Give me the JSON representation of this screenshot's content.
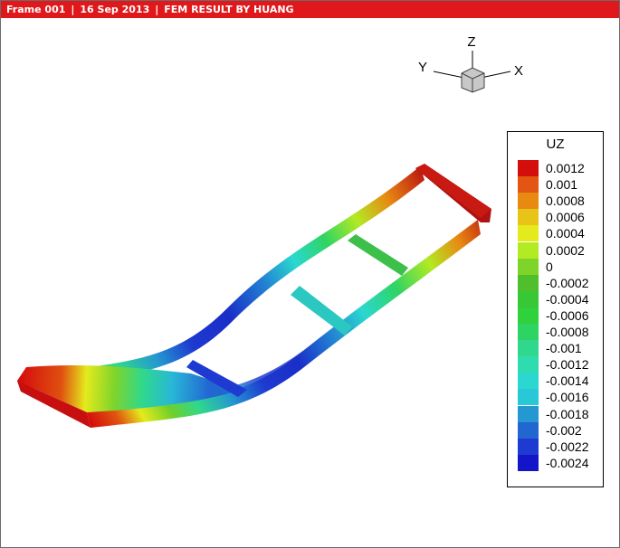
{
  "titlebar": {
    "frame": "Frame 001",
    "date": "16 Sep 2013",
    "title": "FEM RESULT BY HUANG",
    "separator": "|"
  },
  "axes_triad": {
    "x": "X",
    "y": "Y",
    "z": "Z"
  },
  "legend": {
    "title": "UZ",
    "entries": [
      {
        "label": "0.0012",
        "color": "#d40d0d"
      },
      {
        "label": "0.001",
        "color": "#e25512"
      },
      {
        "label": "0.0008",
        "color": "#e88a12"
      },
      {
        "label": "0.0006",
        "color": "#e8c419"
      },
      {
        "label": "0.0004",
        "color": "#e4ea1d"
      },
      {
        "label": "0.0002",
        "color": "#b2ea23"
      },
      {
        "label": "0",
        "color": "#7fd42a"
      },
      {
        "label": "-0.0002",
        "color": "#4fc02c"
      },
      {
        "label": "-0.0004",
        "color": "#38c835"
      },
      {
        "label": "-0.0006",
        "color": "#2fd23c"
      },
      {
        "label": "-0.0008",
        "color": "#2ed463"
      },
      {
        "label": "-0.001",
        "color": "#2fd88d"
      },
      {
        "label": "-0.0012",
        "color": "#2fdcb0"
      },
      {
        "label": "-0.0014",
        "color": "#2ad8cf"
      },
      {
        "label": "-0.0016",
        "color": "#28c8d6"
      },
      {
        "label": "-0.0018",
        "color": "#2498d0"
      },
      {
        "label": "-0.002",
        "color": "#2266d2"
      },
      {
        "label": "-0.0022",
        "color": "#1e3ad0"
      },
      {
        "label": "-0.0024",
        "color": "#1414c8"
      }
    ]
  }
}
